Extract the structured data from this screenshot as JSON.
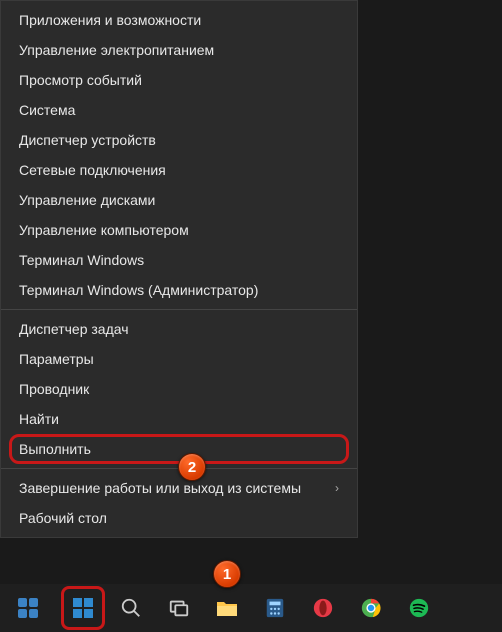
{
  "menu": {
    "groups": [
      [
        "Приложения и возможности",
        "Управление электропитанием",
        "Просмотр событий",
        "Система",
        "Диспетчер устройств",
        "Сетевые подключения",
        "Управление дисками",
        "Управление компьютером",
        "Терминал Windows",
        "Терминал Windows (Администратор)"
      ],
      [
        "Диспетчер задач",
        "Параметры",
        "Проводник",
        "Найти",
        "Выполнить"
      ],
      [
        "Завершение работы или выход из системы",
        "Рабочий стол"
      ]
    ],
    "submenu_items": [
      "Завершение работы или выход из системы"
    ],
    "highlighted_item": "Выполнить"
  },
  "markers": {
    "1": "1",
    "2": "2"
  },
  "taskbar": {
    "items": [
      {
        "name": "start",
        "label": "Start"
      },
      {
        "name": "search",
        "label": "Search"
      },
      {
        "name": "task-view",
        "label": "Task View"
      },
      {
        "name": "explorer",
        "label": "File Explorer"
      },
      {
        "name": "calculator",
        "label": "Calculator"
      },
      {
        "name": "opera",
        "label": "Opera"
      },
      {
        "name": "chrome",
        "label": "Google Chrome"
      },
      {
        "name": "spotify",
        "label": "Spotify"
      }
    ]
  }
}
